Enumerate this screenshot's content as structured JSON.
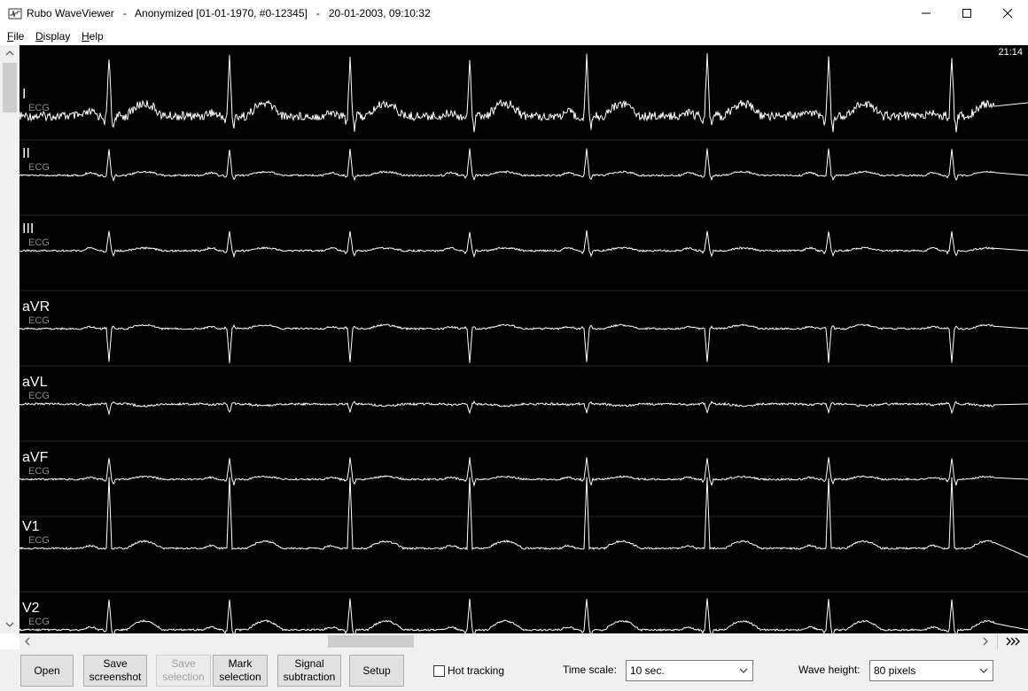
{
  "window": {
    "app_name": "Rubo WaveViewer",
    "title": "Rubo WaveViewer   -   Anonymized [01-01-1970, #0-12345]   -   20-01-2003, 09:10:32"
  },
  "menu": [
    {
      "label": "File",
      "accel": "F",
      "rest": "ile"
    },
    {
      "label": "Display",
      "accel": "D",
      "rest": "isplay"
    },
    {
      "label": "Help",
      "accel": "H",
      "rest": "elp"
    }
  ],
  "viewer": {
    "clock": "21:14",
    "background": "#000000",
    "trace_color": "#ffffff",
    "channels": [
      {
        "name": "I",
        "type": "ECG"
      },
      {
        "name": "II",
        "type": "ECG"
      },
      {
        "name": "III",
        "type": "ECG"
      },
      {
        "name": "aVR",
        "type": "ECG"
      },
      {
        "name": "aVL",
        "type": "ECG"
      },
      {
        "name": "aVF",
        "type": "ECG"
      },
      {
        "name": "V1",
        "type": "ECG"
      },
      {
        "name": "V2",
        "type": "ECG"
      }
    ]
  },
  "scroll": {
    "fast_forward_icon": "fast-forward-icon"
  },
  "toolbar": {
    "open": "Open",
    "save_screenshot": [
      "Save",
      "screenshot"
    ],
    "save_selection": [
      "Save",
      "selection"
    ],
    "mark_selection": [
      "Mark",
      "selection"
    ],
    "signal_subtraction": [
      "Signal",
      "subtraction"
    ],
    "setup": "Setup",
    "hot_tracking": {
      "label": "Hot tracking",
      "checked": false
    },
    "time_scale": {
      "label": "Time scale:",
      "value": "10 sec."
    },
    "wave_height": {
      "label": "Wave height:",
      "value": "80 pixels"
    }
  }
}
